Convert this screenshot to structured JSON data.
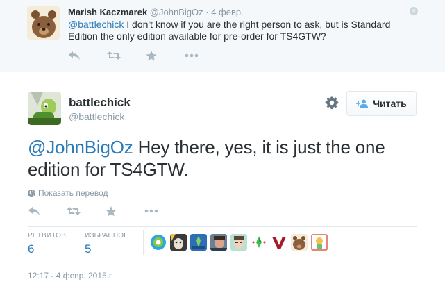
{
  "parent_tweet": {
    "fullname": "Marish Kaczmarek",
    "handle": "@JohnBigOz",
    "separator": "·",
    "date": "4 февр.",
    "mention": "@battlechick",
    "text": " I don't know if you are the right person to ask, but is Standard Edition the only edition available for pre-order for TS4GTW?"
  },
  "tweet": {
    "fullname": "battlechick",
    "handle": "@battlechick",
    "follow_label": "Читать",
    "mention": "@JohnBigOz",
    "text": " Hey there, yes, it is just the one edition for TS4GTW.",
    "translate_label": "Показать перевод",
    "retweets_label": "РЕТВИТОВ",
    "retweets_count": "6",
    "favorites_label": "ИЗБРАННОЕ",
    "favorites_count": "5",
    "timestamp": "12:17 - 4 февр. 2015 г."
  },
  "colors": {
    "link": "#2b7bb9",
    "muted": "#8899a6",
    "action_icon": "#aab8c2",
    "follow_icon": "#55acee"
  },
  "icons": [
    "reply-icon",
    "retweet-icon",
    "favorite-icon",
    "more-icon",
    "gear-icon",
    "follow-user-icon",
    "globe-icon"
  ]
}
